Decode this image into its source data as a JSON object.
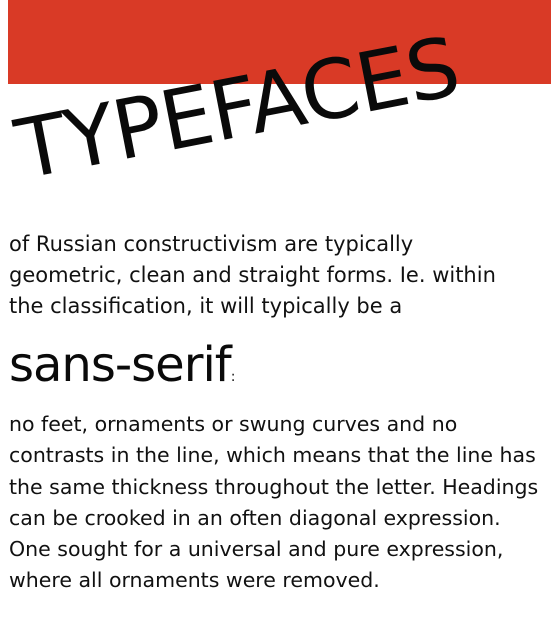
{
  "colors": {
    "banner": "#d93a26",
    "text": "#111111",
    "background": "#ffffff"
  },
  "headline": "TYPEFACES",
  "intro_text": "of Russian constructivism are typically geometric, clean and straight forms. Ie. within the classification, it will typically be a",
  "term": "sans-serif",
  "term_suffix": ":",
  "body_text": "no feet, ornaments or swung curves and no contrasts in the line, which means that the line has the same thickness throughout the letter. Headings can be crooked in an often diagonal expression. One sought for a universal and pure expression, where all ornaments were removed."
}
